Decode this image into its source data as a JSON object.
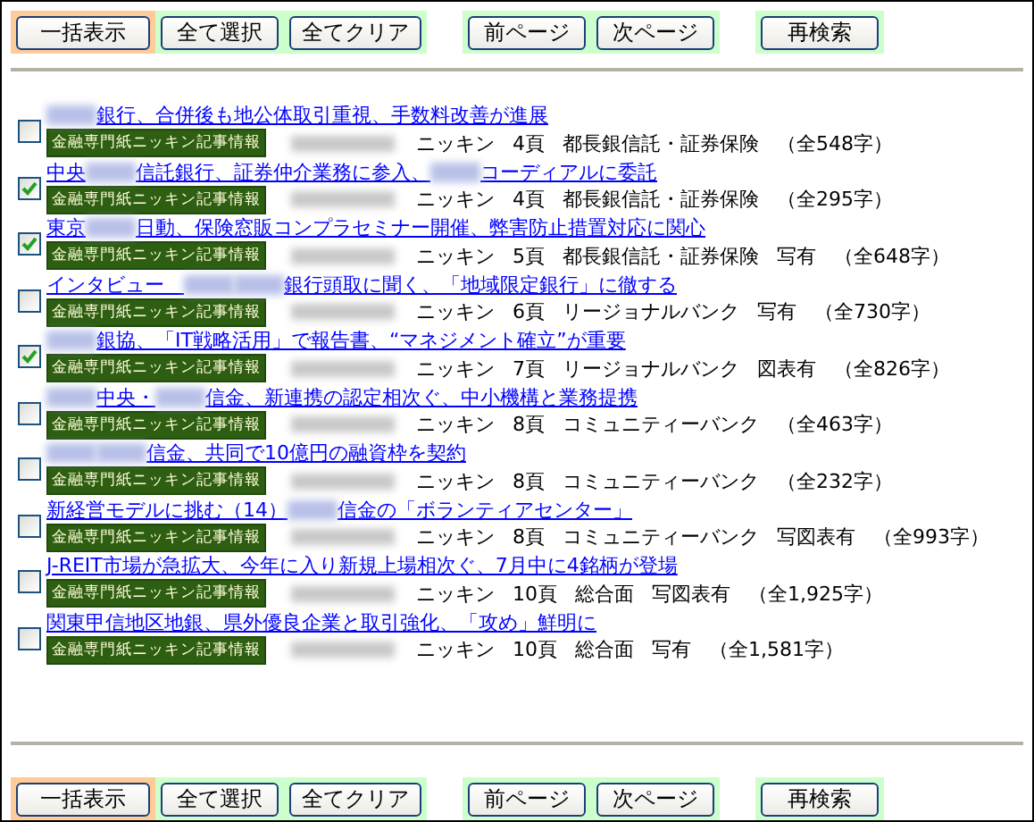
{
  "toolbar_top": [
    {
      "color": "#ffcc99",
      "buttons": [
        "一括表示"
      ]
    },
    {
      "color": "#ccffcc",
      "buttons": [
        "全て選択",
        "全てクリア"
      ]
    },
    {
      "color": "#ccffcc",
      "buttons": [
        "前ページ",
        "次ページ"
      ]
    },
    {
      "color": "#ccffcc",
      "buttons": [
        "再検索"
      ]
    }
  ],
  "articles": [
    {
      "checked": false,
      "title": [
        {
          "kind": "redacted"
        },
        {
          "kind": "text",
          "text": "銀行、合併後も地公体取引重視、手数料改善が進展"
        }
      ],
      "badge": "金融専門紙ニッキン記事情報",
      "paper": "ニッキン",
      "page": "4頁",
      "section": "都長銀信託・証券保険",
      "length": "（全548字）"
    },
    {
      "checked": true,
      "title": [
        {
          "kind": "text",
          "text": "中央"
        },
        {
          "kind": "redacted"
        },
        {
          "kind": "text",
          "text": "信託銀行、証券仲介業務に参入、"
        },
        {
          "kind": "redacted"
        },
        {
          "kind": "text",
          "text": "コーディアルに委託"
        }
      ],
      "badge": "金融専門紙ニッキン記事情報",
      "paper": "ニッキン",
      "page": "4頁",
      "section": "都長銀信託・証券保険",
      "length": "（全295字）"
    },
    {
      "checked": true,
      "title": [
        {
          "kind": "text",
          "text": "東京"
        },
        {
          "kind": "redacted"
        },
        {
          "kind": "text",
          "text": "日動、保険窓販コンプラセミナー開催、弊害防止措置対応に関心"
        }
      ],
      "badge": "金融専門紙ニッキン記事情報",
      "paper": "ニッキン",
      "page": "5頁",
      "section": "都長銀信託・証券保険",
      "extra": "写有",
      "length": "（全648字）"
    },
    {
      "checked": false,
      "title": [
        {
          "kind": "text",
          "text": "インタビュー　"
        },
        {
          "kind": "redacted"
        },
        {
          "kind": "redacted"
        },
        {
          "kind": "text",
          "text": "銀行頭取に聞く、「地域限定銀行」に徹する"
        }
      ],
      "badge": "金融専門紙ニッキン記事情報",
      "paper": "ニッキン",
      "page": "6頁",
      "section": "リージョナルバンク",
      "extra": "写有",
      "length": "（全730字）"
    },
    {
      "checked": true,
      "title": [
        {
          "kind": "redacted"
        },
        {
          "kind": "text",
          "text": "銀協、「IT戦略活用」で報告書、“マネジメント確立”が重要"
        }
      ],
      "badge": "金融専門紙ニッキン記事情報",
      "paper": "ニッキン",
      "page": "7頁",
      "section": "リージョナルバンク",
      "extra": "図表有",
      "length": "（全826字）"
    },
    {
      "checked": false,
      "title": [
        {
          "kind": "redacted"
        },
        {
          "kind": "text",
          "text": "中央・"
        },
        {
          "kind": "redacted"
        },
        {
          "kind": "text",
          "text": "信金、新連携の認定相次ぐ、中小機構と業務提携"
        }
      ],
      "badge": "金融専門紙ニッキン記事情報",
      "paper": "ニッキン",
      "page": "8頁",
      "section": "コミュニティーバンク",
      "length": "（全463字）"
    },
    {
      "checked": false,
      "title": [
        {
          "kind": "redacted"
        },
        {
          "kind": "redacted"
        },
        {
          "kind": "text",
          "text": "信金、共同で10億円の融資枠を契約"
        }
      ],
      "badge": "金融専門紙ニッキン記事情報",
      "paper": "ニッキン",
      "page": "8頁",
      "section": "コミュニティーバンク",
      "length": "（全232字）"
    },
    {
      "checked": false,
      "title": [
        {
          "kind": "text",
          "text": "新経営モデルに挑む（14）"
        },
        {
          "kind": "redacted"
        },
        {
          "kind": "text",
          "text": "信金の「ボランティアセンター」"
        }
      ],
      "badge": "金融専門紙ニッキン記事情報",
      "paper": "ニッキン",
      "page": "8頁",
      "section": "コミュニティーバンク",
      "extra": "写図表有",
      "length": "（全993字）"
    },
    {
      "checked": false,
      "title": [
        {
          "kind": "text",
          "text": "J-REIT市場が急拡大、今年に入り新規上場相次ぐ、7月中に4銘柄が登場"
        }
      ],
      "badge": "金融専門紙ニッキン記事情報",
      "paper": "ニッキン",
      "page": "10頁",
      "section": "総合面",
      "extra": "写図表有",
      "length": "（全1,925字）"
    },
    {
      "checked": false,
      "title": [
        {
          "kind": "text",
          "text": "関東甲信地区地銀、県外優良企業と取引強化、「攻め」鮮明に"
        }
      ],
      "badge": "金融専門紙ニッキン記事情報",
      "paper": "ニッキン",
      "page": "10頁",
      "section": "総合面",
      "extra": "写有",
      "length": "（全1,581字）"
    }
  ],
  "toolbar_bottom": [
    {
      "color": "#ffcc99",
      "buttons": [
        "一括表示"
      ]
    },
    {
      "color": "#ccffcc",
      "buttons": [
        "全て選択",
        "全てクリア"
      ]
    },
    {
      "color": "#ccffcc",
      "buttons": [
        "前ページ",
        "次ページ"
      ]
    },
    {
      "color": "#ccffcc",
      "buttons": [
        "再検索"
      ]
    }
  ]
}
